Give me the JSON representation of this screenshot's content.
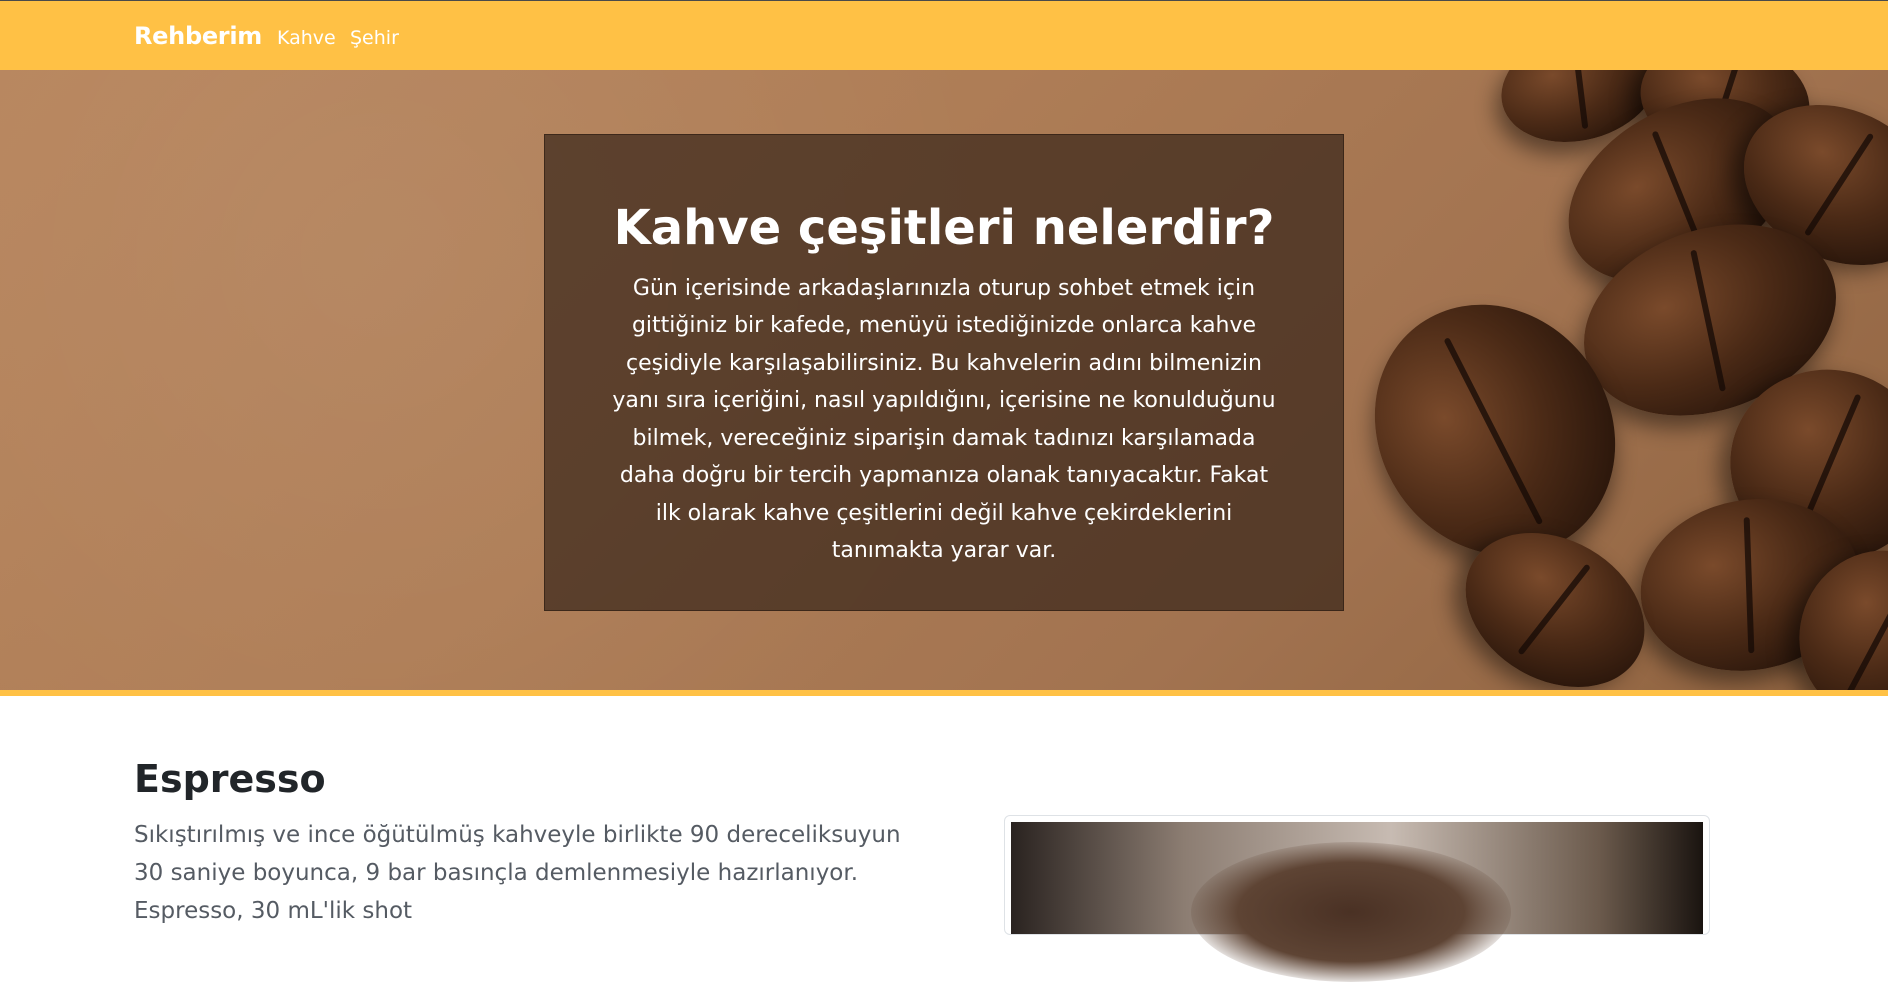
{
  "navbar": {
    "brand": "Rehberim",
    "links": [
      "Kahve",
      "Şehir"
    ],
    "color": "#ffc145"
  },
  "hero": {
    "title": "Kahve çeşitleri nelerdir?",
    "text": "Gün içerisinde arkadaşlarınızla oturup sohbet etmek için gittiğiniz bir kafede, menüyü istediğinizde onlarca kahve çeşidiyle karşılaşabilirsiniz. Bu kahvelerin adını bilmenizin yanı sıra içeriğini, nasıl yapıldığını, içerisine ne konulduğunu bilmek, vereceğiniz siparişin damak tadınızı karşılamada daha doğru bir tercih yapmanıza olanak tanıyacaktır. Fakat ilk olarak kahve çeşitlerini değil kahve çekirdeklerini tanımakta yarar var.",
    "background": "coffee-beans-on-kraft-paper",
    "overlay_color": "#3a271b"
  },
  "section": {
    "title": "Espresso",
    "text": "Sıkıştırılmış ve ince öğütülmüş kahveyle birlikte 90 dereceliksuyun 30 saniye boyunca, 9 bar basınçla demlenmesiyle hazırlanıyor. Espresso, 30 mL'lik shot",
    "image": "espresso-cup-photo"
  }
}
